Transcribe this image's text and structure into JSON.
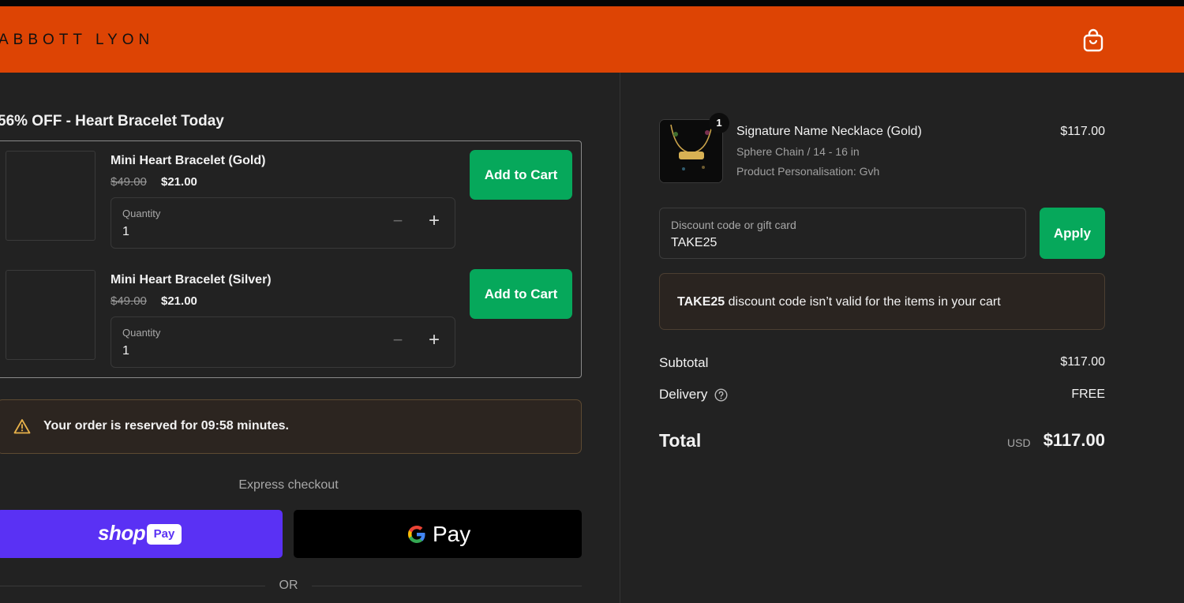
{
  "header": {
    "logo_text": "ABBOTT LYON",
    "bg_color": "#dd4404",
    "cart_icon": "shopping-bag-icon"
  },
  "upsell": {
    "title": "56% OFF - Heart Bracelet Today",
    "items": [
      {
        "name": "Mini Heart Bracelet (Gold)",
        "original_price": "$49.00",
        "sale_price": "$21.00",
        "quantity_label": "Quantity",
        "quantity": "1",
        "minus_symbol": "−",
        "plus_symbol": "+",
        "button_label": "Add to Cart"
      },
      {
        "name": "Mini Heart Bracelet (Silver)",
        "original_price": "$49.00",
        "sale_price": "$21.00",
        "quantity_label": "Quantity",
        "quantity": "1",
        "minus_symbol": "−",
        "plus_symbol": "+",
        "button_label": "Add to Cart"
      }
    ],
    "button_color": "#06a85b"
  },
  "reservation": {
    "icon": "warning-icon",
    "message": "Your order is reserved for 09:58 minutes."
  },
  "express": {
    "label": "Express checkout",
    "shop_pay_word": "shop",
    "shop_pay_pill": "Pay",
    "google_pay_word": "Pay",
    "shop_pay_color": "#5a31f4",
    "or_label": "OR"
  },
  "order": {
    "quantity_badge": "1",
    "product_name": "Signature Name Necklace (Gold)",
    "variant": "Sphere Chain / 14 - 16 in",
    "personalisation": "Product Personalisation: Gvh",
    "price": "$117.00"
  },
  "discount": {
    "label": "Discount code or gift card",
    "value": "TAKE25",
    "button_label": "Apply",
    "error_code": "TAKE25",
    "error_message": " discount code isn’t valid for the items in your cart"
  },
  "summary": {
    "subtotal_label": "Subtotal",
    "subtotal_value": "$117.00",
    "delivery_label": "Delivery",
    "delivery_value": "FREE",
    "total_label": "Total",
    "currency": "USD",
    "total_value": "$117.00"
  }
}
